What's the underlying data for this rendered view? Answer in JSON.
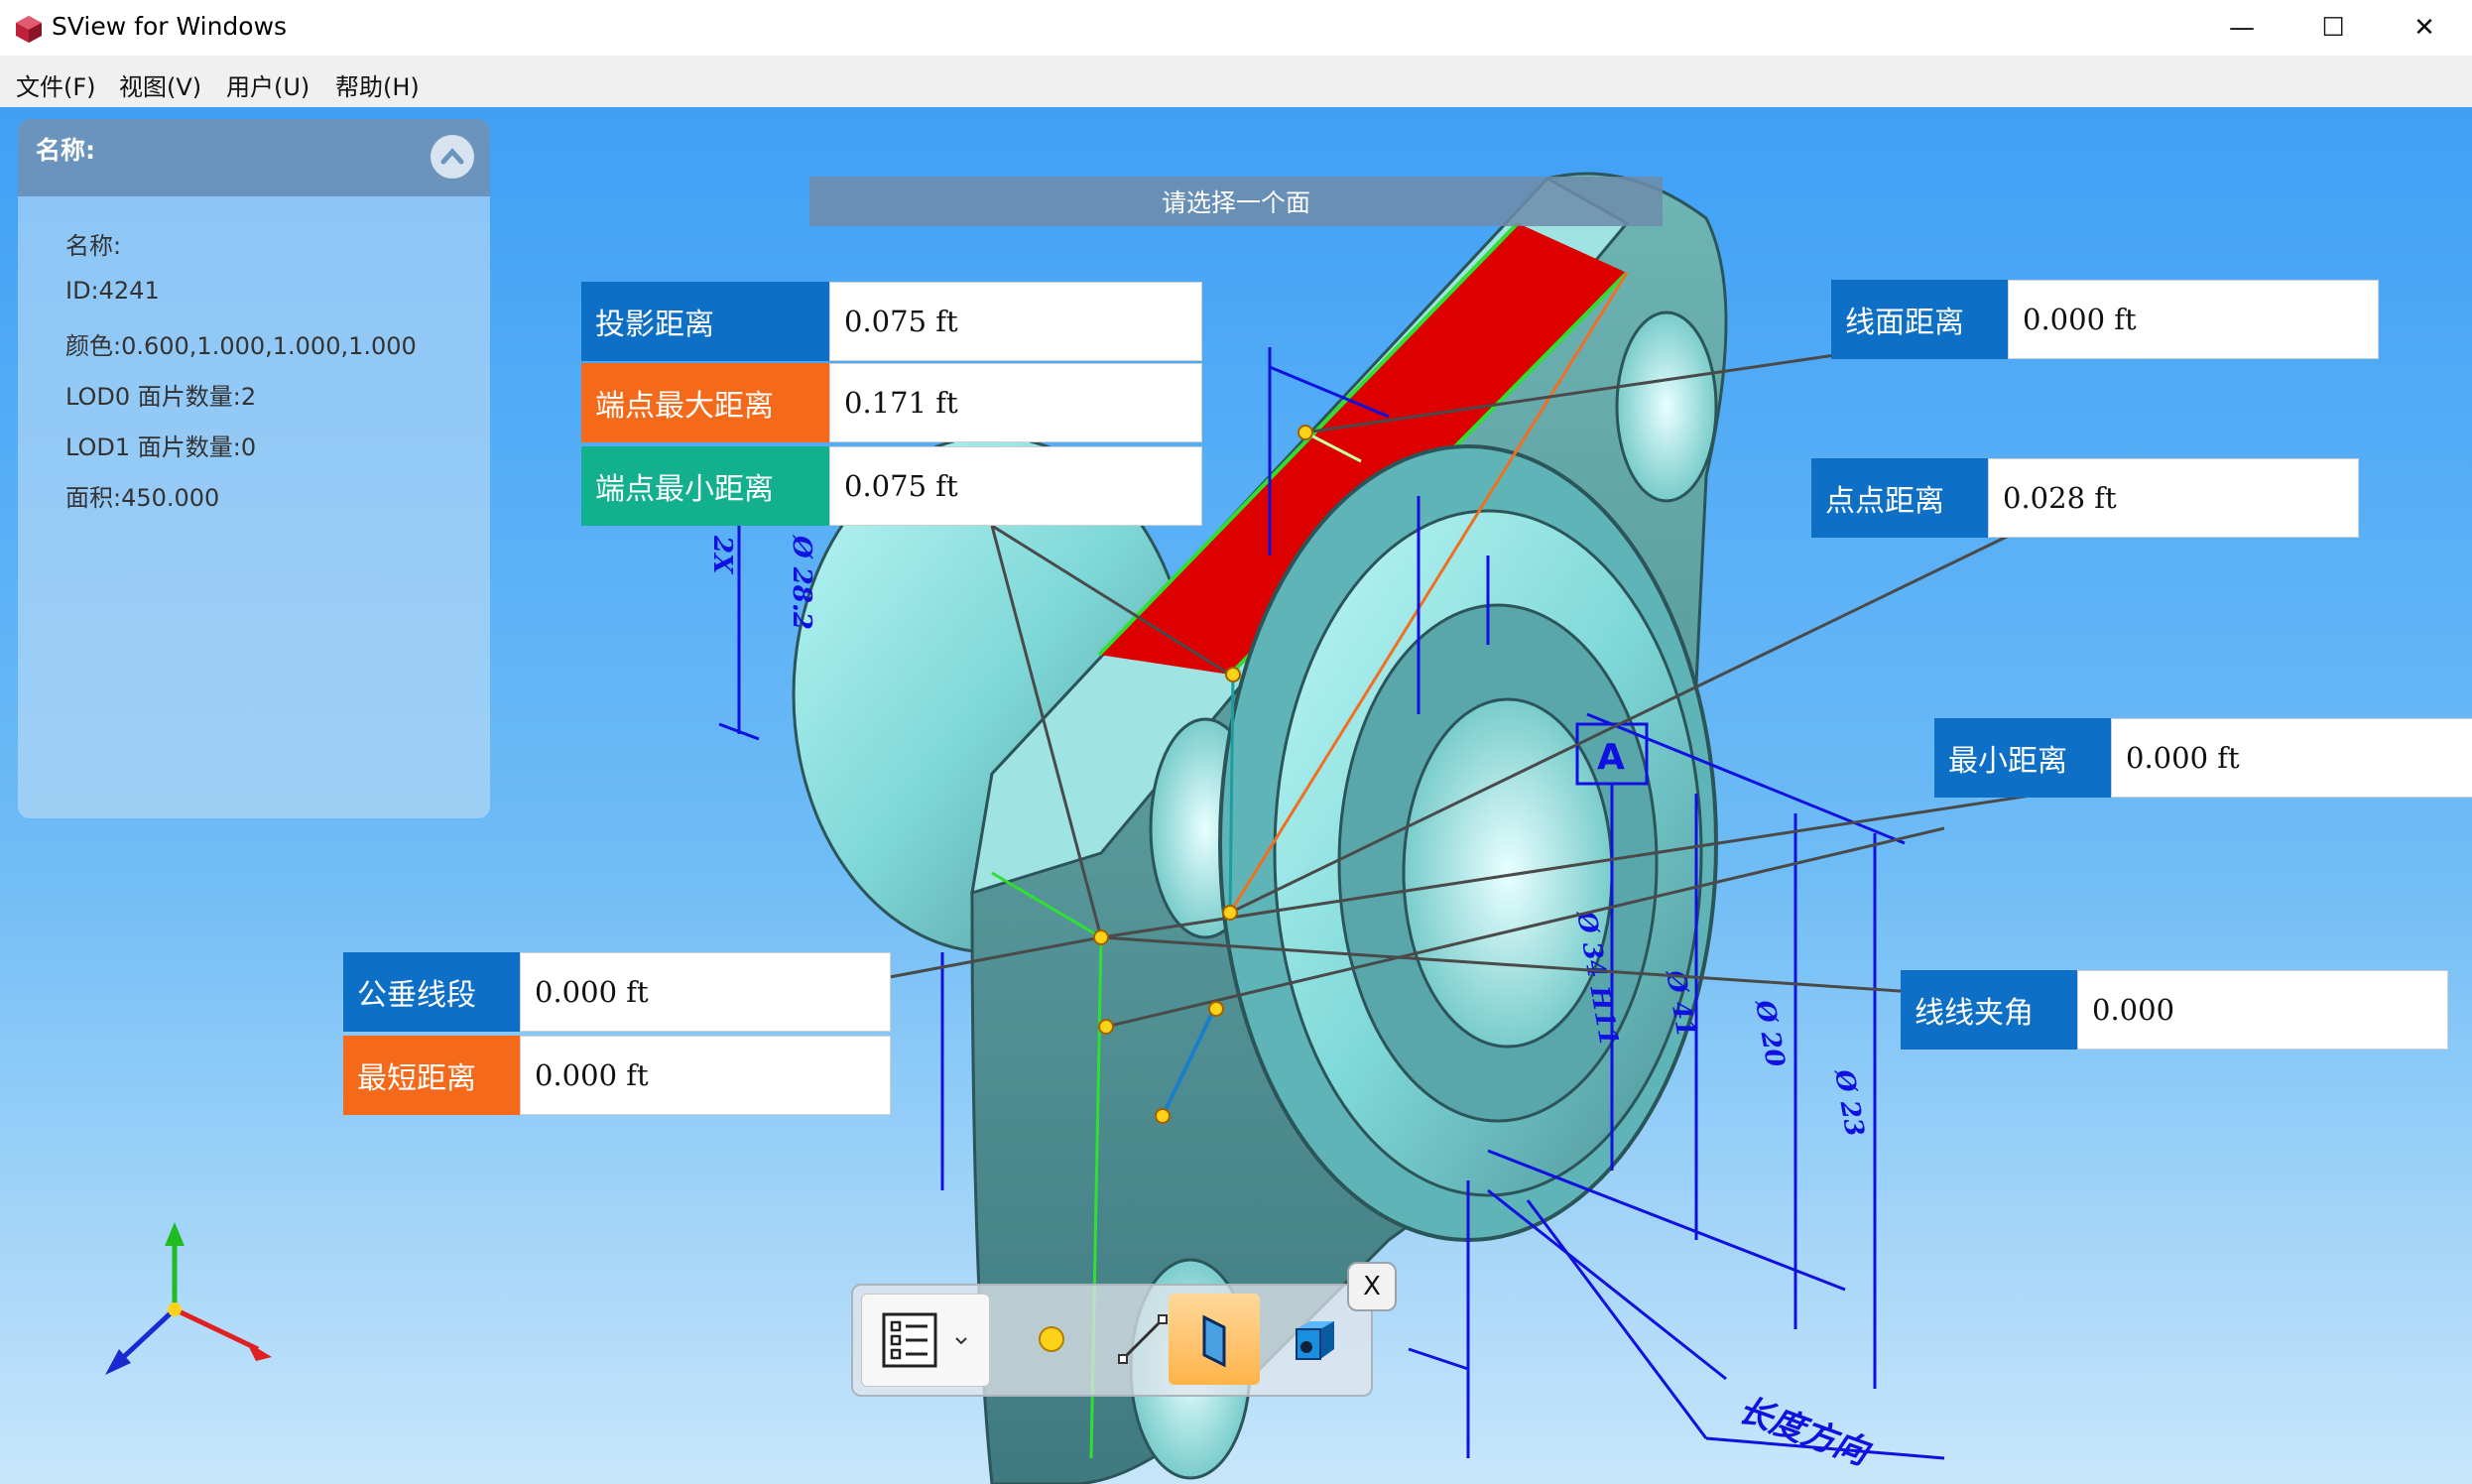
{
  "window": {
    "title": "SView for Windows",
    "minimize": "—",
    "maximize": "☐",
    "close": "✕"
  },
  "menu": [
    {
      "label": "文件(F)"
    },
    {
      "label": "视图(V)"
    },
    {
      "label": "用户(U)"
    },
    {
      "label": "帮助(H)"
    }
  ],
  "info_panel": {
    "title": "名称:",
    "lines": [
      "名称:",
      "ID:4241",
      "颜色:0.600,1.000,1.000,1.000",
      "LOD0 面片数量:2",
      "LOD1 面片数量:0",
      "面积:450.000"
    ]
  },
  "status": "请选择一个面",
  "measurements": {
    "projection": {
      "label": "投影距离",
      "value": "0.075 ft"
    },
    "endpoint_max": {
      "label": "端点最大距离",
      "value": "0.171 ft"
    },
    "endpoint_min": {
      "label": "端点最小距离",
      "value": "0.075 ft"
    },
    "line_face": {
      "label": "线面距离",
      "value": "0.000 ft"
    },
    "point_point": {
      "label": "点点距离",
      "value": "0.028 ft"
    },
    "min_distance": {
      "label": "最小距离",
      "value": "0.000 ft"
    },
    "line_angle": {
      "label": "线线夹角",
      "value": "0.000"
    },
    "common_perp": {
      "label": "公垂线段",
      "value": "0.000 ft"
    },
    "shortest": {
      "label": "最短距离",
      "value": "0.000 ft"
    }
  },
  "annotations": {
    "datum": "A",
    "dim1": "Ø 28.2",
    "dim2": "Ø 34 H11",
    "dim3": "Ø 41",
    "dim4": "Ø 20",
    "dim5": "Ø 23",
    "dim6": "2X",
    "note": "长度方向"
  },
  "toolbar": {
    "tools": [
      "list-tool",
      "point-tool",
      "line-tool",
      "face-tool",
      "solid-tool"
    ],
    "close": "X"
  },
  "colors": {
    "accent_blue": "#0e6fc7",
    "accent_orange": "#f56a1a",
    "accent_teal": "#12b08e",
    "selected_face": "#dd0000"
  }
}
